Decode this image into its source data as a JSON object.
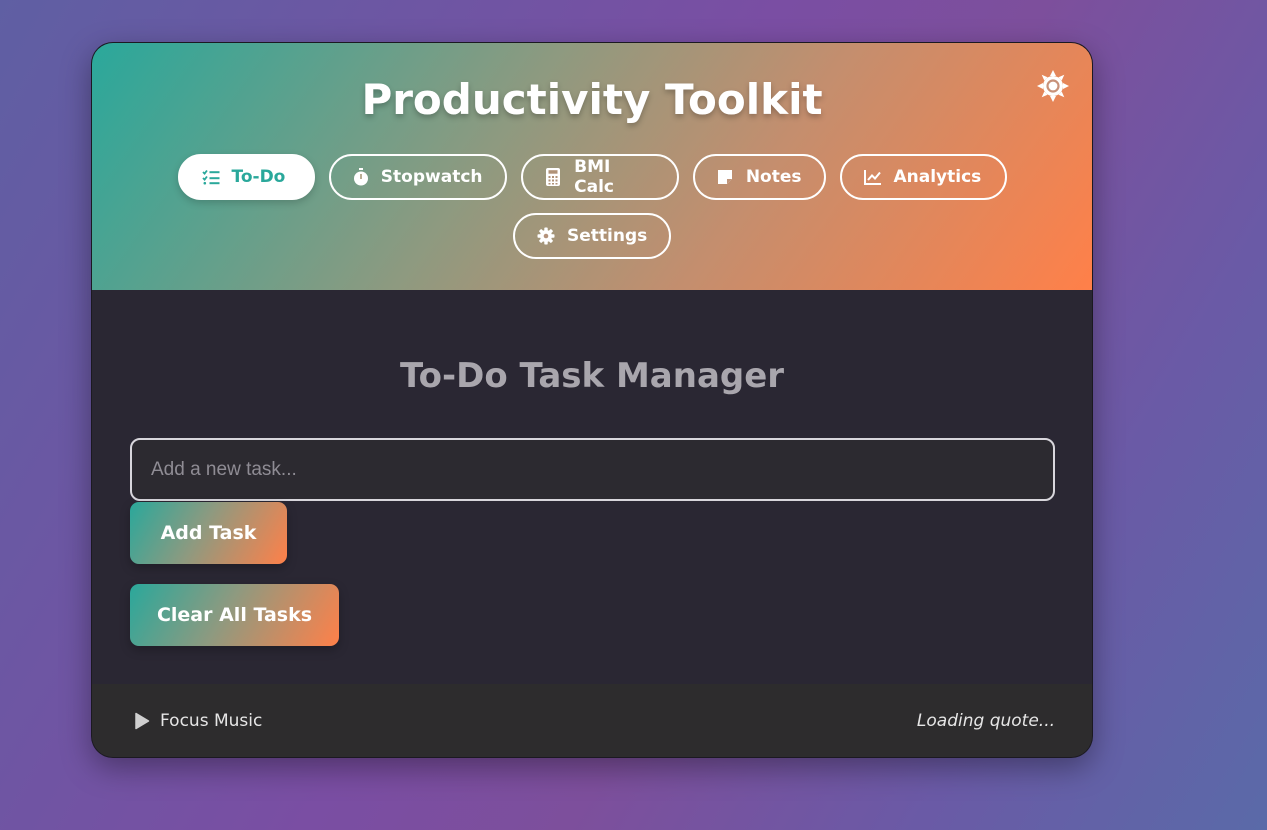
{
  "app": {
    "title": "Productivity Toolkit"
  },
  "header": {
    "theme_icon": "sun-icon",
    "tabs": [
      {
        "label": "To-Do",
        "icon": "checklist-icon",
        "active": true
      },
      {
        "label": "Stopwatch",
        "icon": "stopwatch-icon",
        "active": false
      },
      {
        "label": "BMI Calc",
        "icon": "calculator-icon",
        "active": false
      },
      {
        "label": "Notes",
        "icon": "note-icon",
        "active": false
      },
      {
        "label": "Analytics",
        "icon": "chart-line-icon",
        "active": false
      },
      {
        "label": "Settings",
        "icon": "gear-icon",
        "active": false
      }
    ]
  },
  "todo": {
    "title": "To-Do Task Manager",
    "input_placeholder": "Add a new task...",
    "input_value": "",
    "add_label": "Add Task",
    "clear_label": "Clear All Tasks"
  },
  "footer": {
    "music_label": "Focus Music",
    "music_icon": "play-icon",
    "quote": "Loading quote..."
  },
  "colors": {
    "accent_teal": "#2aa89b",
    "accent_orange": "#ff8049",
    "panel_bg": "#2a2733",
    "footer_bg": "#2d2c2d"
  }
}
